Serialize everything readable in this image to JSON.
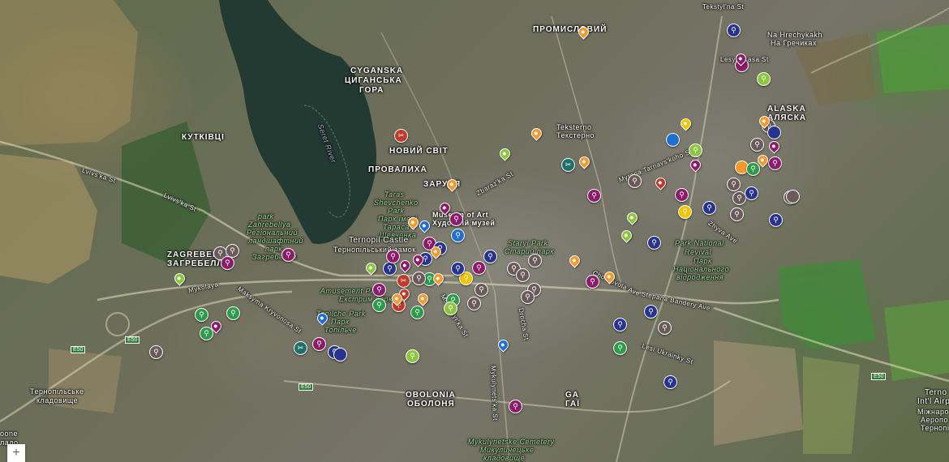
{
  "map": {
    "colors": {
      "purple": "#8e1b6a",
      "navy": "#27338f",
      "gray": "#6b5a5a",
      "green": "#2c9c4a",
      "teal": "#1f6f6a",
      "orange": "#f29a2e",
      "lime": "#8cc63f",
      "red": "#c0392b",
      "blue": "#1e6fd1",
      "yellow": "#f2c400"
    },
    "labels": {
      "cyganska_latin": "CYGANSKA",
      "cyganska_cyr1": "ЦИГАНСЬКА",
      "cyganska_cyr2": "ГОРА",
      "kutkivci": "КУТКІВЦІ",
      "seret_river": "Seret River",
      "promyslovyi": "ПРОМИСЛОВИЙ",
      "novyi_svit": "НОВИЙ СВІТ",
      "provalyha": "ПРОВАЛИХА",
      "zarudka": "ЗАРУДЯ",
      "taras_en": "Taras",
      "taras_en2": "Shevchenko",
      "taras_en3": "Park",
      "taras_uk1": "Парк імені",
      "taras_uk2": "Тараса",
      "taras_uk3": "Шевченка",
      "museum_en": "Museum of Art",
      "museum_uk": "Художній музей",
      "castle_en": "Ternopil Castle",
      "castle_uk": "Тернопільський замок",
      "park_zahrebellya": "park",
      "park_zahrebellya2": "Zahrebellya",
      "park_zahrebellya3": "Регіональний",
      "park_zahrebellya4": "ландшафтний",
      "park_zahrebellya5": "парк",
      "park_zahrebellya6": "Загребелля",
      "zagrebella_latin": "ZAGREBELLA",
      "zagrebella_cyr": "ЗАГРЕБЕЛЛЯ",
      "amusement": "Amusement Park",
      "amusement_uk": "Екстрим парк",
      "topilche": "Topilche Park",
      "topilche_uk1": "Парк",
      "topilche_uk2": "Топільче",
      "staryi_park_en": "Staryi Park",
      "staryi_park_uk": "Старий парк",
      "national_revival1": "Park National",
      "national_revival2": "Revival",
      "national_revival3": "Парк",
      "national_revival4": "Національного",
      "national_revival5": "відродження",
      "teksterno": "Teksterno",
      "teksterno_uk": "Текстерно",
      "alaska_latin": "ALASKA",
      "alaska_cyr": "АЛЯСКА",
      "na_hrechykakh": "Na Hrechykakh",
      "na_hrechykakh_uk": "На Гречиках",
      "obolonia": "OBOLONIA",
      "obolonia_uk": "ОБОЛОНЯ",
      "cemetery_en": "Mykulynetske Cemetery",
      "cemetery_uk1": "Микулинецьке",
      "cemetery_uk2": "кладовище",
      "ternopilske_1": "Тернопільське",
      "ternopilske_2": "кладовище",
      "airport1": "Terno",
      "airport2": "Int'l Airp",
      "airport3": "Міжнаро",
      "airport4": "Аеропо",
      "airport5": "Тернопі",
      "ga": "ГАЇ",
      "ga_latin": "GA",
      "kone": "oone",
      "kone2": "ладо"
    },
    "streets": {
      "lvivska_1": "Lvivs'ka St",
      "lvivska_2": "Lvivs'ka St",
      "tekstylna": "Tekstyl'na St",
      "lesya": "Lesya",
      "tarasa": "asa St",
      "mykulynetska": "Mykulynets'ka St",
      "stepana_bandery": "Stepana Bandery Ave",
      "ukrainky": "Lesi Ukrainky St",
      "drocha": "Drocha St",
      "zbaraz": "Zbaraz'ka St",
      "chorn": "Chornovola Ave",
      "manastyrs": "Monastyr'ka St",
      "maksyma": "Maksyma Kryvonosa St",
      "mykolaya": "Mykolaya",
      "e50_1": "E50",
      "e50_2": "E50",
      "e50_3": "E50",
      "e50_4": "E50",
      "myrona": "Myrona Tarnavs'koho St",
      "zhyva": "Zhyva Ave"
    },
    "zoom_in_label": "+"
  }
}
